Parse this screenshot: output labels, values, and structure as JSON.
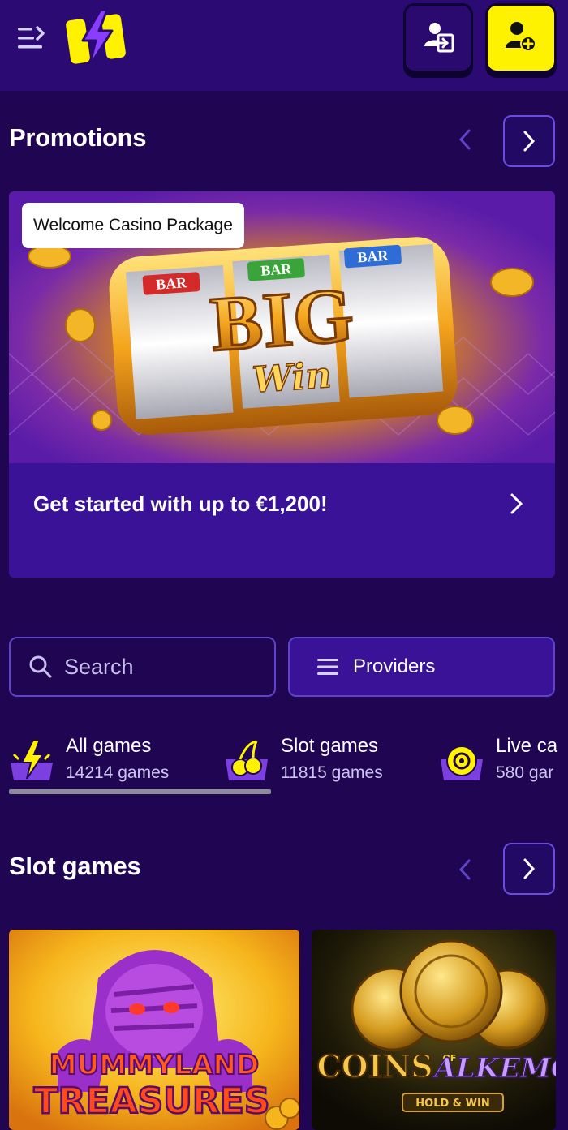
{
  "header": {
    "menu_icon": "menu-expand-icon",
    "logo_icon": "lightning-bolt-logo",
    "login_icon": "login-icon",
    "register_icon": "add-user-icon",
    "colors": {
      "header_bg": "#2b0a73",
      "register_bg": "#fff200",
      "page_bg": "#1f0552"
    }
  },
  "promotions": {
    "title": "Promotions",
    "cards": [
      {
        "badge": "Welcome Casino Package",
        "text": "Get started with up to €1,200!"
      }
    ],
    "banner_lettering": {
      "reel_top": "BAR",
      "big": "BIG",
      "win": "Win"
    }
  },
  "search": {
    "placeholder": "Search"
  },
  "providers": {
    "label": "Providers"
  },
  "categories": [
    {
      "label": "All games",
      "count": "14214 games",
      "icon": "lightning-icon",
      "active": true
    },
    {
      "label": "Slot games",
      "count": "11815 games",
      "icon": "cherries-icon",
      "active": false
    },
    {
      "label": "Live ca",
      "count": "580 gar",
      "icon": "roulette-chip-icon",
      "active": false
    }
  ],
  "slot_games": {
    "title": "Slot games",
    "games": [
      {
        "line1": "MUMMYLAND",
        "line2": "TREASURES"
      },
      {
        "line1": "COINS",
        "of": "OF",
        "line1b": "ALKEMO",
        "line2": "HOLD & WIN"
      }
    ]
  }
}
